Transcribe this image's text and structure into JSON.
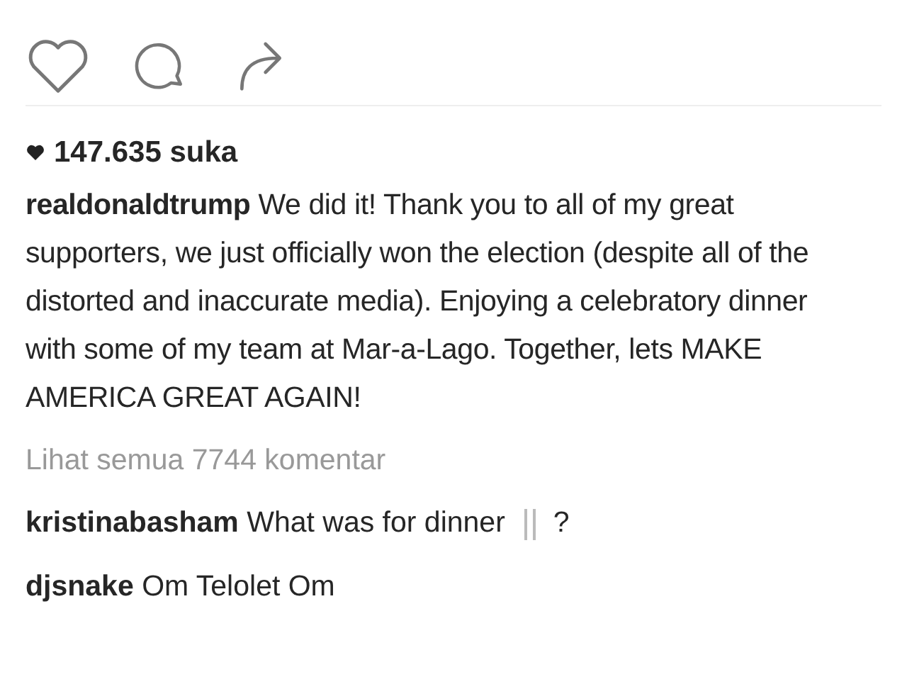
{
  "likes": {
    "count": "147.635 suka"
  },
  "caption": {
    "username": "realdonaldtrump",
    "text": "We did it! Thank you to all of my great supporters, we just officially won the election (despite all of the distorted and inaccurate media). Enjoying a celebratory dinner with some of my team at Mar-a-Lago. Together, lets MAKE AMERICA GREAT AGAIN!"
  },
  "view_all_comments": "Lihat semua 7744 komentar",
  "comments": [
    {
      "username": "kristinabasham",
      "text": "What was for dinner",
      "kind": "cutlery",
      "after": "?"
    },
    {
      "username": "djsnake",
      "text": "Om Telolet Om",
      "kind": "plain"
    }
  ]
}
